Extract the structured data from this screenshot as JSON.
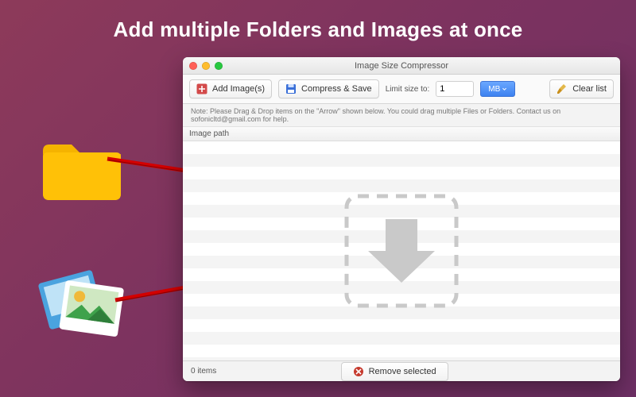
{
  "promo": {
    "headline": "Add multiple Folders and Images at once"
  },
  "window": {
    "title": "Image Size Compressor"
  },
  "toolbar": {
    "add_label": "Add Image(s)",
    "compress_label": "Compress & Save",
    "limit_label": "Limit size to:",
    "limit_value": "1",
    "unit_label": "MB",
    "clear_label": "Clear list"
  },
  "note": {
    "text": "Note: Please Drag & Drop items on the \"Arrow\" shown below. You could drag multiple Files or Folders. Contact us on sofonicltd@gmail.com for help."
  },
  "columns": {
    "image_path": "Image path"
  },
  "footer": {
    "count_label": "0 items",
    "remove_label": "Remove selected"
  }
}
